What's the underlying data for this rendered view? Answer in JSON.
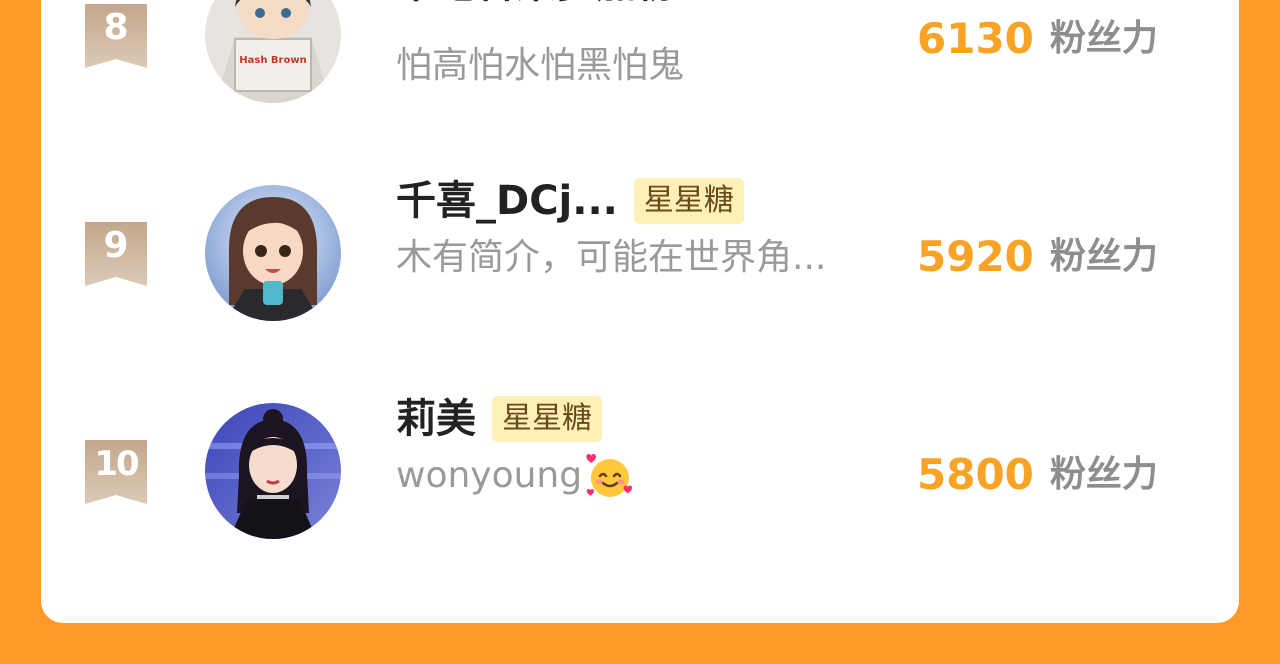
{
  "score_unit": "粉丝力",
  "entries": [
    {
      "rank": "8",
      "name": "不吃香菜多加粉",
      "tag": "",
      "bio": "怕高怕水怕黑怕鬼",
      "score": "6130",
      "avatar_text": "Hash Brown"
    },
    {
      "rank": "9",
      "name": "千喜_DCj...",
      "tag": "星星糖",
      "bio": "木有简介，可能在世界角...",
      "score": "5920"
    },
    {
      "rank": "10",
      "name": "莉美",
      "tag": "星星糖",
      "bio": "wonyoung",
      "bio_emoji": "smiling-face-with-hearts-icon",
      "score": "5800"
    }
  ],
  "colors": {
    "background": "#fd9a26",
    "score": "#f8a324",
    "tag_bg": "#fff0b8",
    "badge": "#cdb39a"
  }
}
